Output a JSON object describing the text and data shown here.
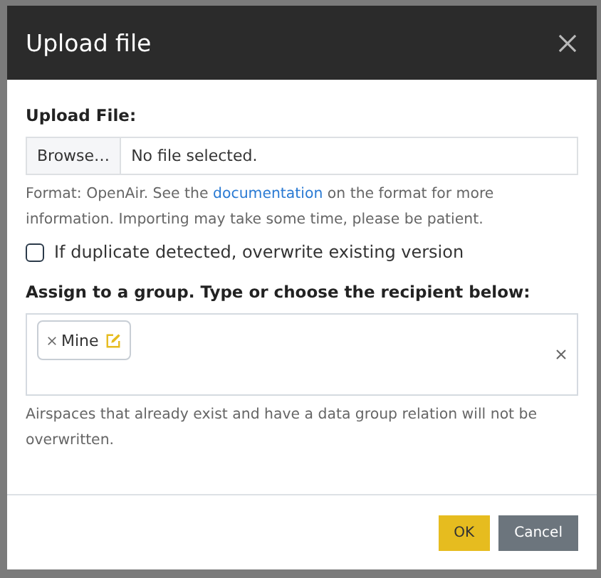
{
  "dialog": {
    "title": "Upload file"
  },
  "upload": {
    "label": "Upload File:",
    "browse": "Browse…",
    "value": "No file selected.",
    "help_before": "Format: OpenAir. See the ",
    "help_link": "documentation",
    "help_after": " on the format for more information. Importing may take some time, please be patient."
  },
  "overwrite": {
    "label": "If duplicate detected, overwrite existing version",
    "checked": false
  },
  "group": {
    "label": "Assign to a group. Type or choose the recipient below:",
    "tags": [
      {
        "label": "Mine"
      }
    ],
    "note": "Airspaces that already exist and have a data group relation will not be overwritten."
  },
  "buttons": [
    {
      "label": "OK",
      "kind": "primary"
    },
    {
      "label": "Cancel",
      "kind": "secondary"
    }
  ]
}
